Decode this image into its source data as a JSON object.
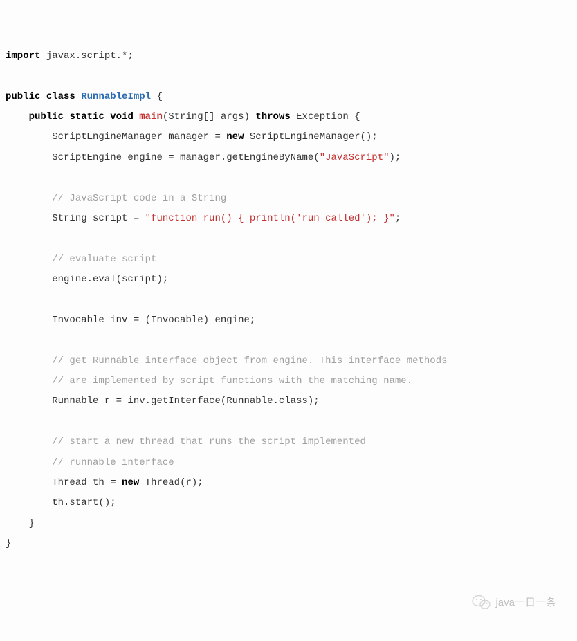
{
  "code": {
    "l1": {
      "kw_import": "import",
      "pkg": " javax.script.*;"
    },
    "l3": {
      "kw_public": "public",
      "kw_class": "class",
      "cls": "RunnableImpl",
      "brace": " {"
    },
    "l4": {
      "kw_public": "public",
      "kw_static": "static",
      "kw_void": "void",
      "method": "main",
      "args": "(String[] args) ",
      "kw_throws": "throws",
      "exc": " Exception {"
    },
    "l5": {
      "a": "ScriptEngineManager manager = ",
      "kw_new": "new",
      "b": " ScriptEngineManager();"
    },
    "l6": {
      "a": "ScriptEngine engine = manager.getEngineByName(",
      "str": "\"JavaScript\"",
      "b": ");"
    },
    "l8": "// JavaScript code in a String",
    "l9": {
      "a": "String script = ",
      "str": "\"function run() { println('run called'); }\"",
      "b": ";"
    },
    "l11": "// evaluate script",
    "l12": "engine.eval(script);",
    "l14": "Invocable inv = (Invocable) engine;",
    "l16": "// get Runnable interface object from engine. This interface methods",
    "l17": "// are implemented by script functions with the matching name.",
    "l18": "Runnable r = inv.getInterface(Runnable.class);",
    "l20": "// start a new thread that runs the script implemented",
    "l21": "// runnable interface",
    "l22": {
      "a": "Thread th = ",
      "kw_new": "new",
      "b": " Thread(r);"
    },
    "l23": "th.start();",
    "l24": "}",
    "l25": "}"
  },
  "watermark": "java一日一条"
}
